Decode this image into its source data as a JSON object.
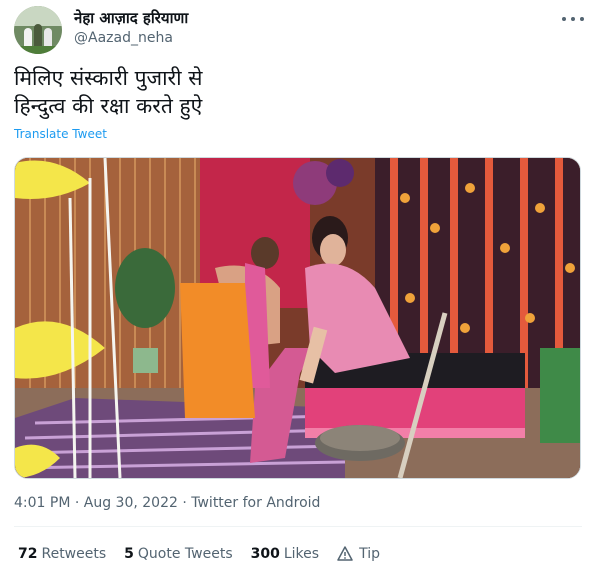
{
  "user": {
    "display_name": "नेहा आज़ाद हरियाणा",
    "handle": "@Aazad_neha"
  },
  "tweet": {
    "text": "मिलिए संस्कारी पुजारी से\nहिन्दुत्व की रक्षा करते हुऐ",
    "translate_label": "Translate Tweet",
    "timestamp": "4:01 PM · Aug 30, 2022 · Twitter for Android"
  },
  "stats": {
    "retweets_count": "72",
    "retweets_label": "Retweets",
    "quotes_count": "5",
    "quotes_label": "Quote Tweets",
    "likes_count": "300",
    "likes_label": "Likes",
    "tip_label": "Tip"
  },
  "icons": {
    "more": "more-icon",
    "tip": "tip-icon"
  },
  "colors": {
    "link": "#1d9bf0",
    "secondary_text": "#536471"
  }
}
